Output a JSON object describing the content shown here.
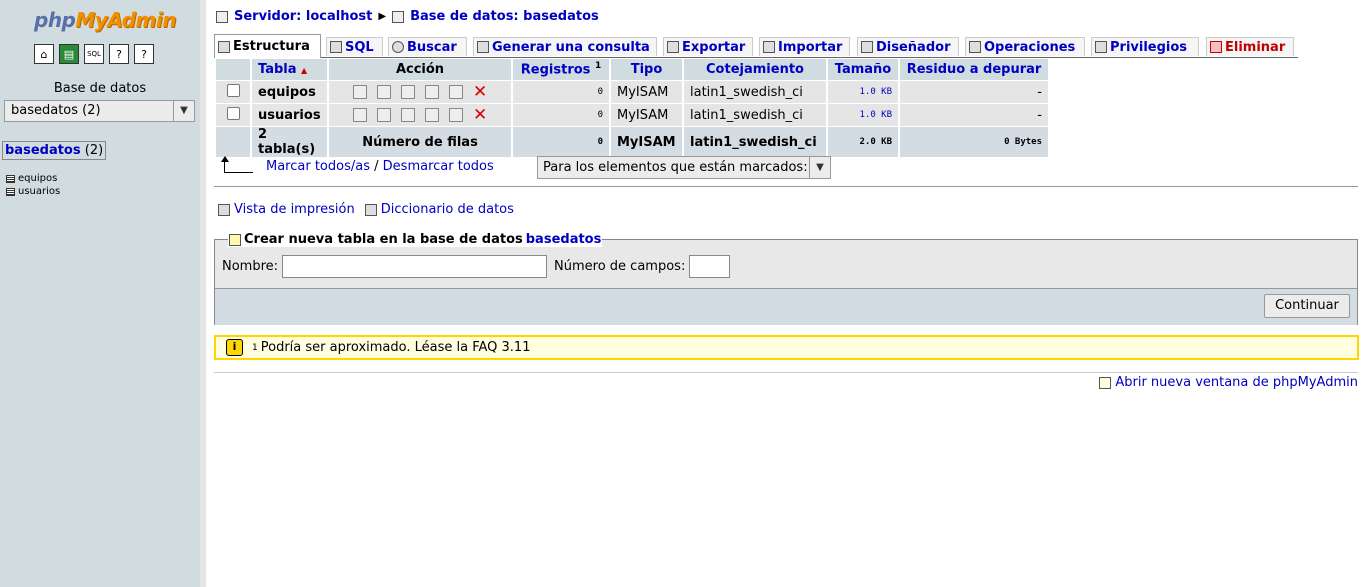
{
  "left": {
    "logo_php": "php",
    "logo_admin": "MyAdmin",
    "nav_icons": [
      "home-icon",
      "query-icon",
      "sql-icon",
      "docs-icon",
      "help-icon"
    ],
    "db_label": "Base de datos",
    "db_select": "basedatos (2)",
    "current_db_name": "basedatos",
    "current_db_count": "(2)",
    "tables": [
      "equipos",
      "usuarios"
    ]
  },
  "breadcrumb": {
    "server": "Servidor: localhost",
    "database": "Base de datos: basedatos"
  },
  "tabs": [
    {
      "label": "Estructura",
      "icon": "structure-icon",
      "active": true
    },
    {
      "label": "SQL",
      "icon": "sql-icon"
    },
    {
      "label": "Buscar",
      "icon": "search-icon"
    },
    {
      "label": "Generar una consulta",
      "icon": "query-icon"
    },
    {
      "label": "Exportar",
      "icon": "export-icon"
    },
    {
      "label": "Importar",
      "icon": "import-icon"
    },
    {
      "label": "Diseñador",
      "icon": "designer-icon"
    },
    {
      "label": "Operaciones",
      "icon": "operations-icon"
    },
    {
      "label": "Privilegios",
      "icon": "privileges-icon"
    },
    {
      "label": "Eliminar",
      "icon": "drop-icon"
    }
  ],
  "table": {
    "headers": {
      "tabla": "Tabla",
      "accion": "Acción",
      "registros": "Registros",
      "registros_sup": "1",
      "tipo": "Tipo",
      "cotejamiento": "Cotejamiento",
      "tamano": "Tamaño",
      "residuo": "Residuo a depurar"
    },
    "rows": [
      {
        "name": "equipos",
        "records": "0",
        "type": "MyISAM",
        "collation": "latin1_swedish_ci",
        "size": "1.0 KB",
        "overhead": "-"
      },
      {
        "name": "usuarios",
        "records": "0",
        "type": "MyISAM",
        "collation": "latin1_swedish_ci",
        "size": "1.0 KB",
        "overhead": "-"
      }
    ],
    "summary": {
      "name": "2 tabla(s)",
      "action": "Número de filas",
      "records": "0",
      "type": "MyISAM",
      "collation": "latin1_swedish_ci",
      "size": "2.0 KB",
      "overhead": "0 Bytes"
    }
  },
  "check_all": "Marcar todos/as",
  "check_sep": "/",
  "uncheck_all": "Desmarcar todos",
  "with_selected": "Para los elementos que están marcados:",
  "print_view": "Vista de impresión",
  "data_dictionary": "Diccionario de datos",
  "create": {
    "legend": "Crear nueva tabla en la base de datos",
    "legend_db": "basedatos",
    "name_label": "Nombre:",
    "name_value": "",
    "fields_label": "Número de campos:",
    "fields_value": "",
    "submit": "Continuar"
  },
  "notice": {
    "sup": "1",
    "text": "Podría ser aproximado. Léase la FAQ 3.11"
  },
  "new_window": "Abrir nueva ventana de phpMyAdmin",
  "colors": {
    "nav_bg": "#d0dce0",
    "link": "#0000c0",
    "danger": "#c00000",
    "notice_border": "#ffd700"
  }
}
